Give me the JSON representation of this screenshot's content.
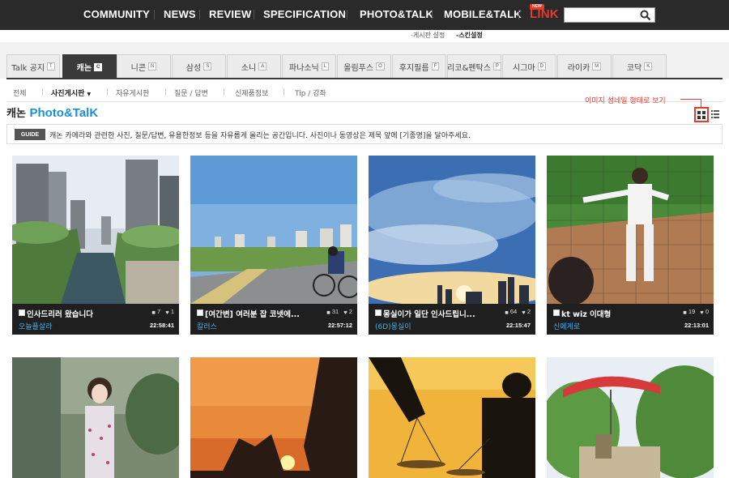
{
  "nav": {
    "items": [
      "COMMUNITY",
      "NEWS",
      "REVIEW",
      "SPECIFICATION",
      "PHOTO&TALK",
      "MOBILE&TALK"
    ],
    "link_label": "LINK",
    "new_badge": "NEW",
    "search_placeholder": ""
  },
  "sublinks": {
    "board_settings": "-게시판 설정",
    "skin_settings": "-스킨설정"
  },
  "tabs": [
    {
      "label": "Talk 공지",
      "key": "T"
    },
    {
      "label": "캐논",
      "key": "C",
      "active": true
    },
    {
      "label": "니콘",
      "key": "N"
    },
    {
      "label": "삼성",
      "key": "S"
    },
    {
      "label": "소니",
      "key": "A"
    },
    {
      "label": "파나소닉",
      "key": "L"
    },
    {
      "label": "올림푸스",
      "key": "O"
    },
    {
      "label": "후지필름",
      "key": "F"
    },
    {
      "label": "리코&펜탁스",
      "key": "P"
    },
    {
      "label": "시그마",
      "key": "D"
    },
    {
      "label": "라이카",
      "key": "M"
    },
    {
      "label": "코닥",
      "key": "K"
    }
  ],
  "submenu": [
    "전체",
    "사진게시판",
    "자유게시판",
    "질문 / 답변",
    "신제품정보",
    "Tip / 강좌"
  ],
  "page_title": {
    "prefix": "캐논",
    "brand": "Photo&TalK"
  },
  "annotation": "이미지 섬네일 형태로 보기",
  "guide": {
    "badge": "GUIDE",
    "text": "캐논 카메라와 관련한 사진, 질문/답변, 유용한정보 등을 자유롭게 올리는 공간입니다. 사진이나 동영상은 제목 앞에 [기종명]을 달아주세요."
  },
  "cards": [
    {
      "title": "인사드리러 왔습니다",
      "comments": "7",
      "likes": "1",
      "author": "오늘플살라",
      "time": "22:58:41"
    },
    {
      "title": "[여간변] 여러분 잡 코넷에...",
      "comments": "31",
      "likes": "2",
      "author": "칼러스",
      "time": "22:57:12"
    },
    {
      "title": "몽실이가 일단 인사드립니...",
      "comments": "64",
      "likes": "2",
      "author": "(6D)몽실이",
      "time": "22:15:47"
    },
    {
      "title": "kt wiz 이대형",
      "comments": "19",
      "likes": "0",
      "author": "신에게로",
      "time": "22:13:01"
    }
  ],
  "colors": {
    "nav_bg": "#2a2a2a",
    "accent_red": "#e8392d",
    "brand_blue": "#1a8fd6",
    "author_blue": "#4bb0e8",
    "active_tab": "#3a3a3a"
  },
  "icons": [
    "search-icon",
    "grid-view-icon",
    "list-view-icon",
    "comment-icon",
    "like-icon"
  ]
}
